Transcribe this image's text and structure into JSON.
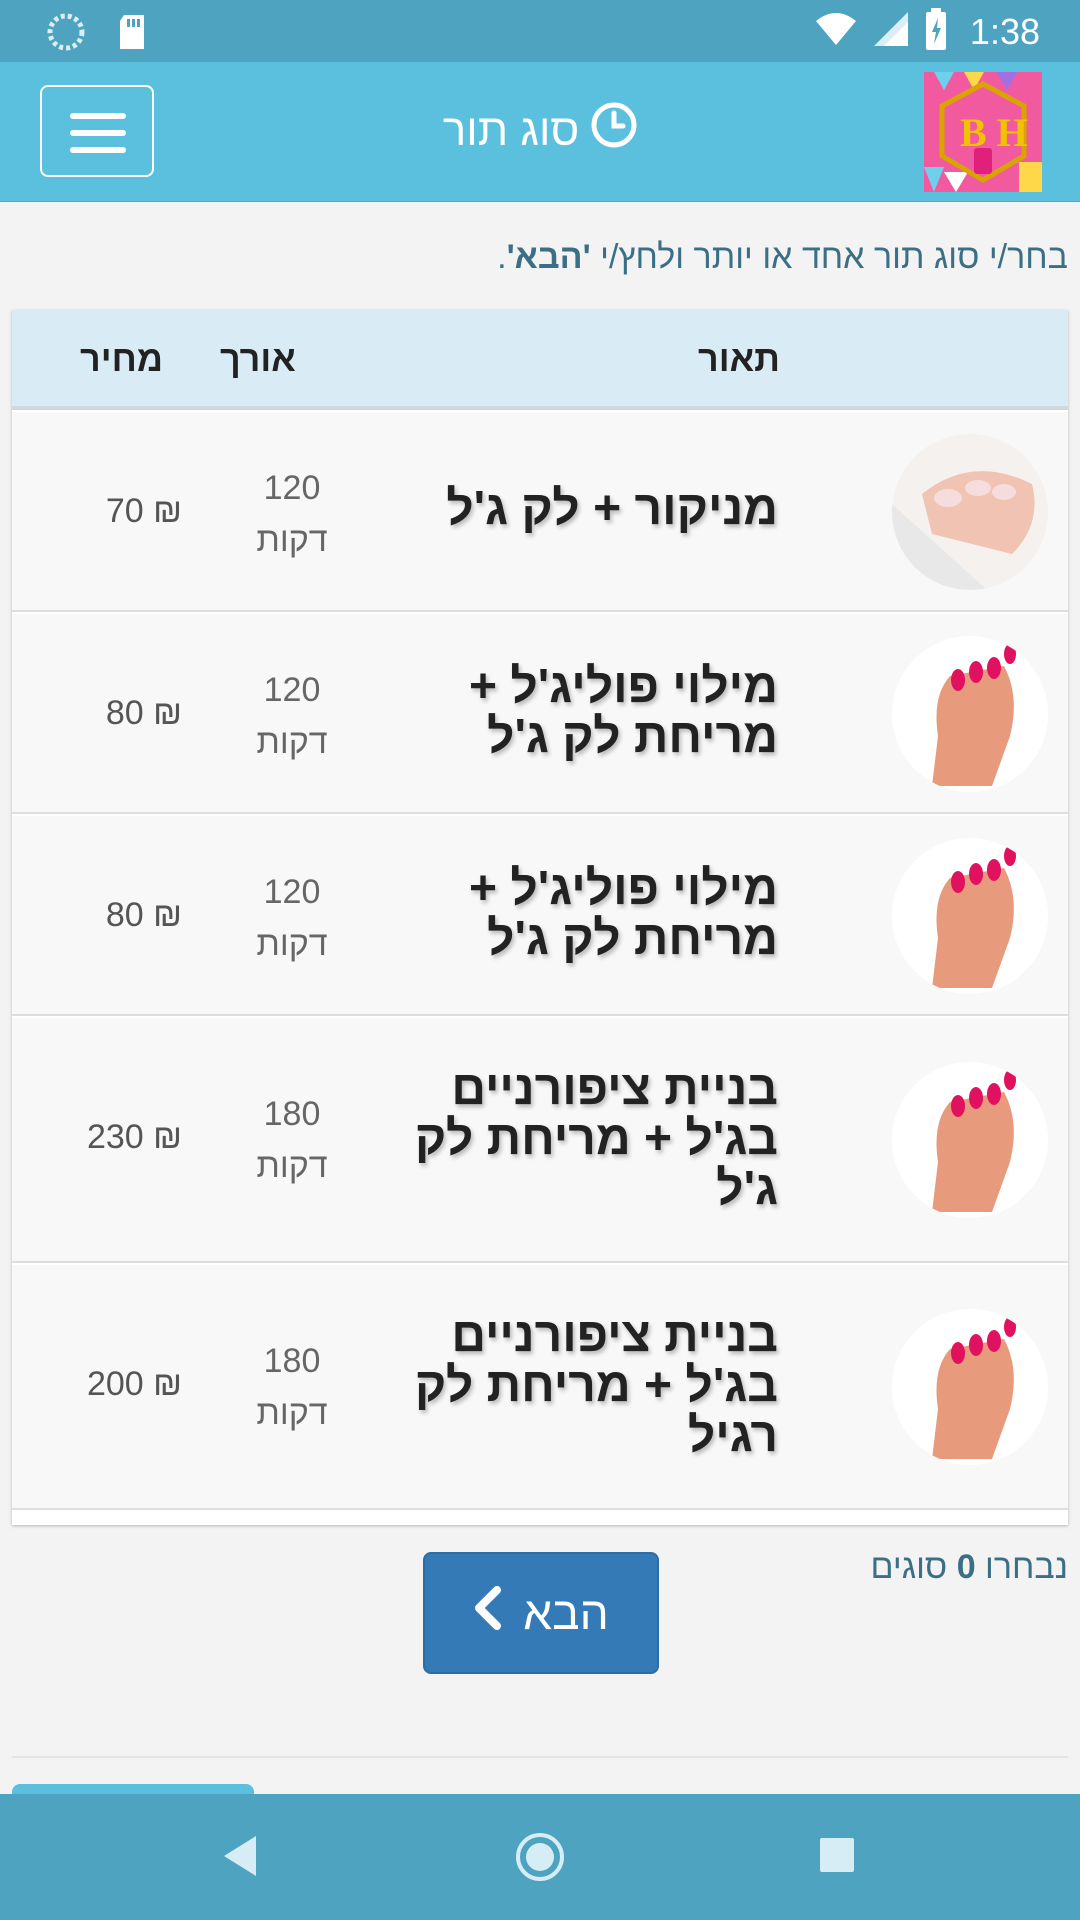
{
  "status_bar": {
    "time": "1:38",
    "icons": [
      "loading-icon",
      "sdcard-icon",
      "wifi-icon",
      "signal-icon",
      "battery-charging-icon"
    ]
  },
  "header": {
    "title": "סוג תור",
    "title_icon": "clock-icon",
    "menu_icon": "hamburger-icon",
    "logo_text": "B H"
  },
  "instructions": {
    "before": "בחר/י סוג תור אחד או יותר ולחץ/י ",
    "highlight": "'הבא'",
    "after": "."
  },
  "table": {
    "columns": {
      "description": "תאור",
      "length": "אורך",
      "price": "מחיר"
    },
    "rows": [
      {
        "description": "מניקור + לק ג'ל",
        "length_value": "120",
        "length_unit": "דקות",
        "price": "70 ₪",
        "image": "manicure-photo"
      },
      {
        "description": "מילוי פוליג'ל + מריחת לק ג'ל",
        "length_value": "120",
        "length_unit": "דקות",
        "price": "80 ₪",
        "image": "pink-nails-photo"
      },
      {
        "description": "מילוי פוליג'ל + מריחת לק ג'ל",
        "length_value": "120",
        "length_unit": "דקות",
        "price": "80 ₪",
        "image": "pink-nails-photo"
      },
      {
        "description": "בניית ציפורניים בג'ל + מריחת לק ג'ל",
        "length_value": "180",
        "length_unit": "דקות",
        "price": "230 ₪",
        "image": "pink-nails-photo"
      },
      {
        "description": "בניית ציפורניים בג'ל + מריחת לק רגיל",
        "length_value": "180",
        "length_unit": "דקות",
        "price": "200 ₪",
        "image": "pink-nails-photo"
      }
    ]
  },
  "footer": {
    "selected_prefix": "נבחרו ",
    "selected_count": "0",
    "selected_suffix": " סוגים",
    "next_label": "הבא"
  },
  "colors": {
    "status_bar": "#4ea3c0",
    "app_bar": "#5bc0de",
    "table_header": "#d9ecf6",
    "primary_button": "#337ab7",
    "text_accent": "#3b6f86"
  }
}
